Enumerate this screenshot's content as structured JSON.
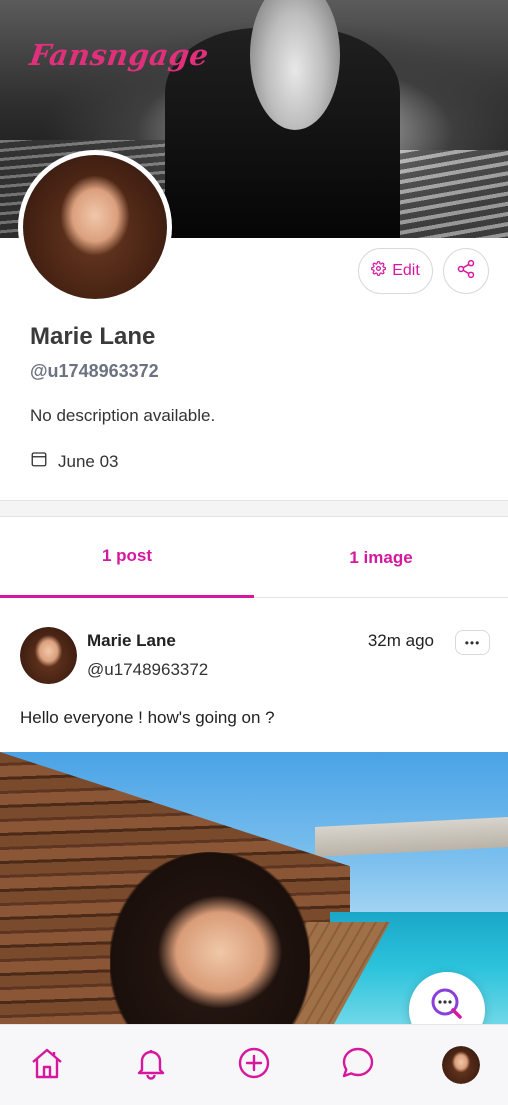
{
  "brand": {
    "logo_text": "Fansngage"
  },
  "profile": {
    "name": "Marie Lane",
    "handle": "@u1748963372",
    "description": "No description available.",
    "joined": "June 03",
    "edit_label": "Edit"
  },
  "tabs": [
    {
      "label": "1 post",
      "active": true
    },
    {
      "label": "1 image",
      "active": false
    }
  ],
  "post": {
    "author": "Marie Lane",
    "handle": "@u1748963372",
    "time": "32m ago",
    "more_label": "•••",
    "text": "Hello everyone ! how's going on ?"
  },
  "nav": {
    "items": [
      "home-icon",
      "bell-icon",
      "plus-circle-icon",
      "chat-icon",
      "profile-avatar"
    ]
  },
  "colors": {
    "accent": "#d6189f",
    "brand": "#e0307c"
  }
}
